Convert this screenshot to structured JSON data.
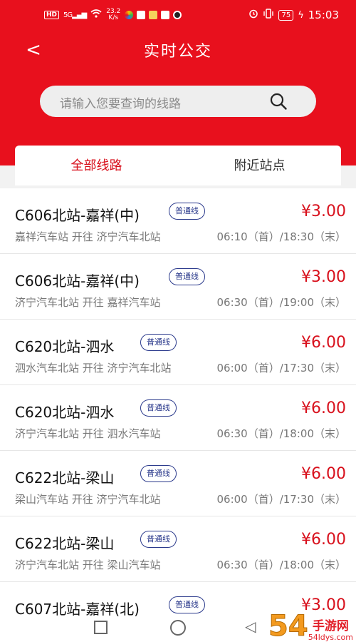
{
  "status_bar": {
    "hd": "HD",
    "signal": "5G",
    "speed_top": "23.2",
    "speed_bottom": "K/s",
    "battery": "75",
    "time": "15:03"
  },
  "header": {
    "back_label": "<",
    "title": "实时公交"
  },
  "search": {
    "placeholder": "请输入您要查询的线路"
  },
  "tabs": [
    {
      "label": "全部线路",
      "active": true
    },
    {
      "label": "附近站点",
      "active": false
    }
  ],
  "routes": [
    {
      "name": "C606北站-嘉祥(中)",
      "type": "普通线",
      "price": "¥3.00",
      "direction": "嘉祥汽车站 开往 济宁汽车北站",
      "schedule": "06:10（首）/18:30（末）"
    },
    {
      "name": "C606北站-嘉祥(中)",
      "type": "普通线",
      "price": "¥3.00",
      "direction": "济宁汽车北站 开往 嘉祥汽车站",
      "schedule": "06:30（首）/19:00（末）"
    },
    {
      "name": "C620北站-泗水",
      "type": "普通线",
      "price": "¥6.00",
      "direction": "泗水汽车北站 开往 济宁汽车北站",
      "schedule": "06:00（首）/17:30（末）"
    },
    {
      "name": "C620北站-泗水",
      "type": "普通线",
      "price": "¥6.00",
      "direction": "济宁汽车北站 开往 泗水汽车站",
      "schedule": "06:30（首）/18:00（末）"
    },
    {
      "name": "C622北站-梁山",
      "type": "普通线",
      "price": "¥6.00",
      "direction": "梁山汽车站 开往 济宁汽车北站",
      "schedule": "06:00（首）/17:30（末）"
    },
    {
      "name": "C622北站-梁山",
      "type": "普通线",
      "price": "¥6.00",
      "direction": "济宁汽车北站 开往 梁山汽车站",
      "schedule": "06:30（首）/18:00（末）"
    },
    {
      "name": "C607北站-嘉祥(北)",
      "type": "普通线",
      "price": "¥3.00",
      "direction": "",
      "schedule": ""
    }
  ],
  "watermark": {
    "number": "54",
    "brand": "手游网",
    "url": "54ldys.com"
  },
  "colors": {
    "brand_red": "#e8101d",
    "price_red": "#d8101c",
    "badge_blue": "#2b3a8c"
  }
}
